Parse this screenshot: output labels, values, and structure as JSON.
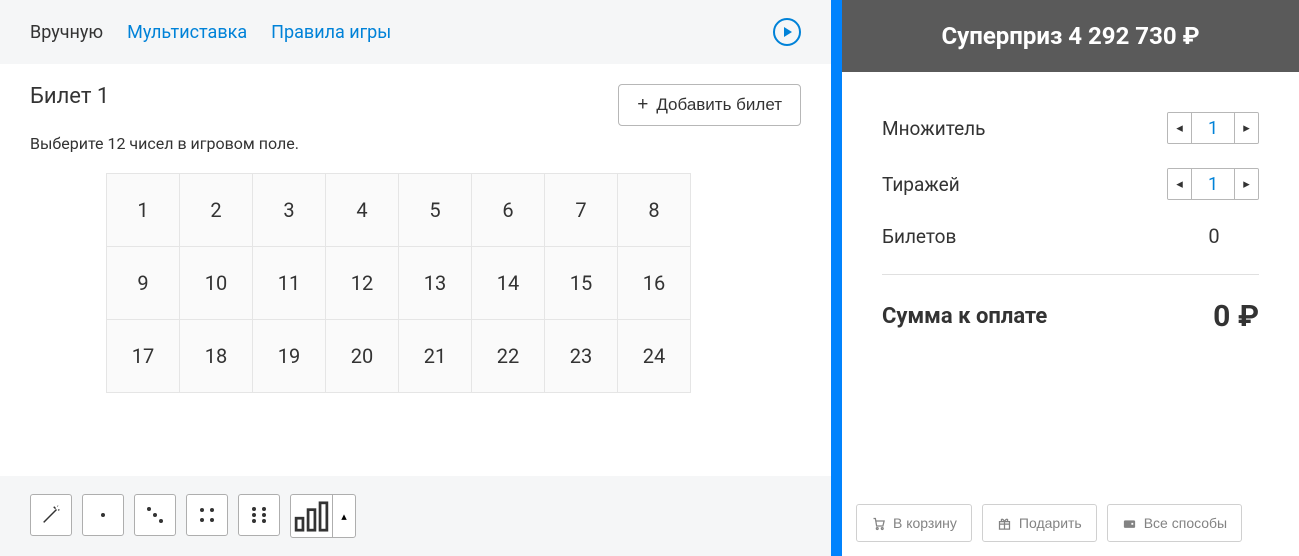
{
  "tabs": {
    "manual": "Вручную",
    "multi": "Мультиставка",
    "rules": "Правила игры"
  },
  "ticket": {
    "title": "Билет 1",
    "hint": "Выберите 12 чисел в игровом поле.",
    "add_button": "Добавить билет",
    "numbers": [
      "1",
      "2",
      "3",
      "4",
      "5",
      "6",
      "7",
      "8",
      "9",
      "10",
      "11",
      "12",
      "13",
      "14",
      "15",
      "16",
      "17",
      "18",
      "19",
      "20",
      "21",
      "22",
      "23",
      "24"
    ]
  },
  "superprize": {
    "label": "Суперприз 4 292 730 ₽"
  },
  "summary": {
    "multiplier_label": "Множитель",
    "multiplier_value": "1",
    "draws_label": "Тиражей",
    "draws_value": "1",
    "tickets_label": "Билетов",
    "tickets_value": "0",
    "total_label": "Сумма к оплате",
    "total_value": "0 ₽"
  },
  "buttons": {
    "cart": "В корзину",
    "gift": "Подарить",
    "all_methods": "Все способы"
  }
}
